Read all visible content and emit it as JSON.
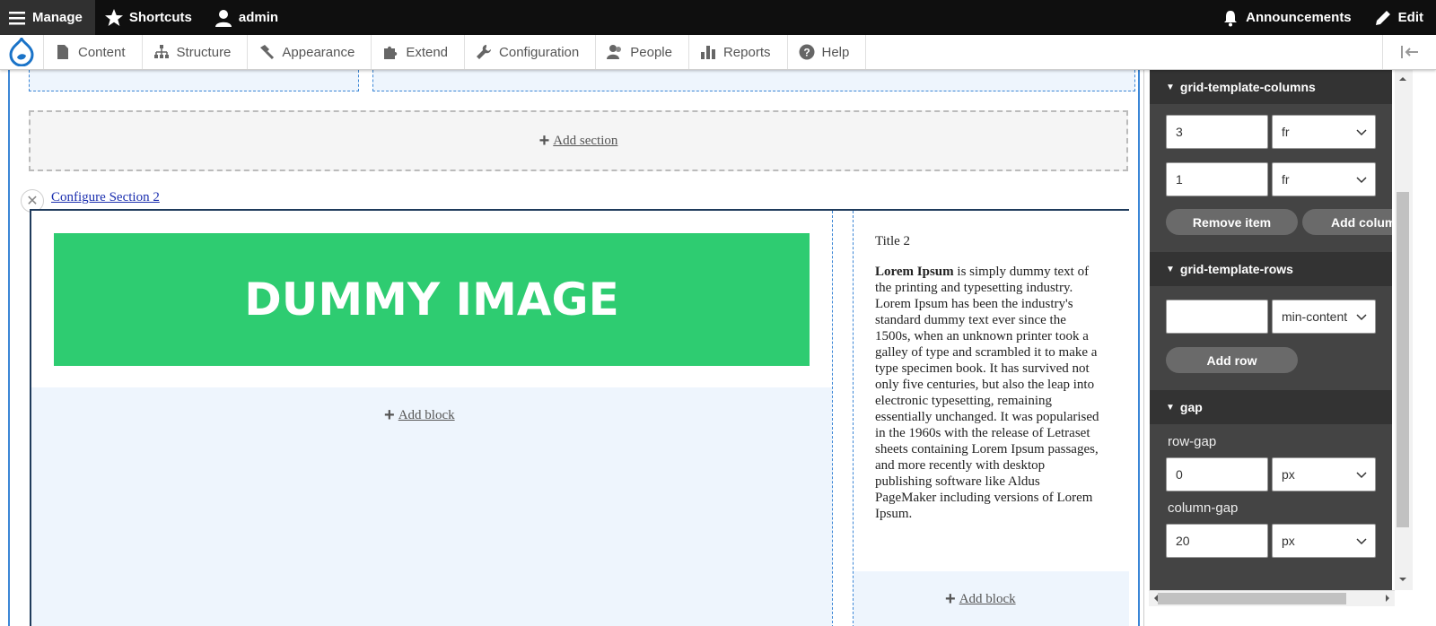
{
  "toolbar": {
    "manage": "Manage",
    "shortcuts": "Shortcuts",
    "user": "admin",
    "announcements": "Announcements",
    "edit": "Edit"
  },
  "menu": {
    "items": [
      "Content",
      "Structure",
      "Appearance",
      "Extend",
      "Configuration",
      "People",
      "Reports",
      "Help"
    ]
  },
  "canvas": {
    "add_section": "Add section",
    "configure_section": "Configure Section 2",
    "dummy_image_text": "DUMMY IMAGE",
    "add_block": "Add block",
    "title": "Title 2",
    "lorem_bold": "Lorem Ipsum",
    "lorem_rest": " is simply dummy text of the printing and typesetting industry. Lorem Ipsum has been the industry's standard dummy text ever since the 1500s, when an unknown printer took a galley of type and scrambled it to make a type specimen book. It has survived not only five centuries, but also the leap into electronic typesetting, remaining essentially unchanged. It was popularised in the 1960s with the release of Letraset sheets containing Lorem Ipsum passages, and more recently with desktop publishing software like Aldus PageMaker including versions of Lorem Ipsum."
  },
  "sidebar": {
    "columns_header": "grid-template-columns",
    "col1_value": "3",
    "col1_unit": "fr",
    "col2_value": "1",
    "col2_unit": "fr",
    "remove_item": "Remove item",
    "add_column": "Add column",
    "rows_header": "grid-template-rows",
    "row1_value": "",
    "row1_unit": "min-content",
    "add_row": "Add row",
    "gap_header": "gap",
    "row_gap_label": "row-gap",
    "row_gap_value": "0",
    "row_gap_unit": "px",
    "column_gap_label": "column-gap",
    "column_gap_value": "20",
    "column_gap_unit": "px"
  },
  "colors": {
    "toolbar_bg": "#0f0f0f",
    "accent_blue": "#3b86d6",
    "dummy_green": "#2ecc71",
    "panel_bg": "#444444"
  }
}
